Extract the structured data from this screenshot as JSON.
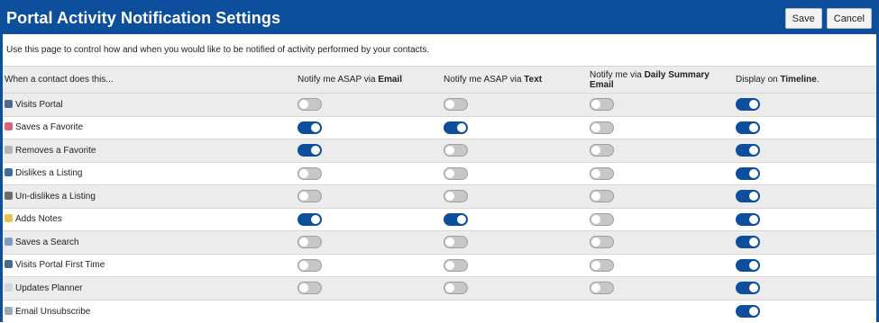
{
  "header": {
    "title": "Portal Activity Notification Settings",
    "save_label": "Save",
    "cancel_label": "Cancel"
  },
  "description": "Use this page to control how and when you would like to be notified of activity performed by your contacts.",
  "columns": [
    {
      "prefix": "When a contact does this...",
      "bold": "",
      "suffix": ""
    },
    {
      "prefix": "Notify me ASAP via ",
      "bold": "Email",
      "suffix": ""
    },
    {
      "prefix": "Notify me ASAP via ",
      "bold": "Text",
      "suffix": ""
    },
    {
      "prefix": "Notify me via ",
      "bold": "Daily Summary Email",
      "suffix": ""
    },
    {
      "prefix": "Display on ",
      "bold": "Timeline",
      "suffix": "."
    }
  ],
  "rows": [
    {
      "label": "Visits Portal",
      "icon": "user-icon",
      "icon_color": "#4a6a8f",
      "settings": [
        false,
        false,
        false,
        true
      ]
    },
    {
      "label": "Saves a Favorite",
      "icon": "heart-icon",
      "icon_color": "#e0607a",
      "settings": [
        true,
        true,
        false,
        true
      ]
    },
    {
      "label": "Removes a Favorite",
      "icon": "heart-gray-icon",
      "icon_color": "#b5b5b5",
      "settings": [
        true,
        false,
        false,
        true
      ]
    },
    {
      "label": "Dislikes a Listing",
      "icon": "thumbs-down-icon",
      "icon_color": "#3b6ea5",
      "settings": [
        false,
        false,
        false,
        true
      ]
    },
    {
      "label": "Un-dislikes a Listing",
      "icon": "thumbs-down-gray-icon",
      "icon_color": "#6c6c6c",
      "settings": [
        false,
        false,
        false,
        true
      ]
    },
    {
      "label": "Adds Notes",
      "icon": "note-icon",
      "icon_color": "#e8c24a",
      "settings": [
        true,
        true,
        false,
        true
      ]
    },
    {
      "label": "Saves a Search",
      "icon": "search-icon",
      "icon_color": "#7b9cc4",
      "settings": [
        false,
        false,
        false,
        true
      ]
    },
    {
      "label": "Visits Portal First Time",
      "icon": "user-icon",
      "icon_color": "#4a6a8f",
      "settings": [
        false,
        false,
        false,
        true
      ]
    },
    {
      "label": "Updates Planner",
      "icon": "planner-icon",
      "icon_color": "#cfd6e0",
      "settings": [
        false,
        false,
        false,
        true
      ]
    },
    {
      "label": "Email Unsubscribe",
      "icon": "envelope-icon",
      "icon_color": "#9aa7b5",
      "settings": [
        null,
        null,
        null,
        true
      ]
    }
  ],
  "colors": {
    "brand": "#0d4f9c",
    "toggle_off": "#c7c7c7",
    "row_alt": "#ececec"
  }
}
